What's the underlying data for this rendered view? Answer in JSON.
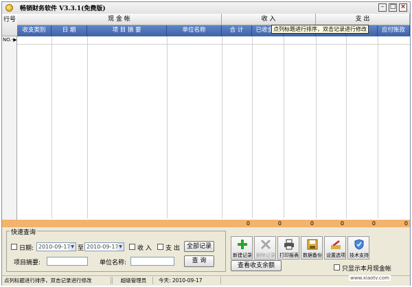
{
  "window": {
    "title": "畅销财务软件 V3.3.1(免费版)"
  },
  "grid": {
    "rownum_header": "行号",
    "groups": {
      "cash": "现 金 帐",
      "income": "收 入",
      "expense": "支 出"
    },
    "columns": [
      "收支类别",
      "日 期",
      "项 目 摘 要",
      "单位名称",
      "合 计",
      "已收金额",
      "",
      "",
      "金额",
      "应付账款"
    ],
    "first_row_label": "NO.-▶",
    "totals": [
      "0",
      "0",
      "0",
      "0",
      "0",
      "0"
    ],
    "tooltip": "点列标题进行排序，双击记录进行修改"
  },
  "quick_query": {
    "title": "快速查询",
    "date_label": "日期:",
    "date_from": "2010-09-17",
    "to_label": "至",
    "date_to": "2010-09-17",
    "income_label": "收 入",
    "expense_label": "支 出",
    "all_records_button": "全部记录",
    "summary_label": "项目摘要:",
    "unit_label": "单位名称:",
    "query_button": "查 询"
  },
  "toolbar": {
    "buttons": [
      {
        "label": "新建记录",
        "icon": "plus-icon",
        "enabled": true
      },
      {
        "label": "删除记录",
        "icon": "delete-icon",
        "enabled": false
      },
      {
        "label": "打印报表",
        "icon": "printer-icon",
        "enabled": true
      },
      {
        "label": "数据备份",
        "icon": "backup-icon",
        "enabled": true
      },
      {
        "label": "设置选项",
        "icon": "settings-icon",
        "enabled": true
      },
      {
        "label": "技术支持",
        "icon": "support-icon",
        "enabled": true
      }
    ],
    "view_balance_button": "查看收支余额",
    "month_only_checkbox": "只显示本月现金帐"
  },
  "status_bar": {
    "hint": "点列标题进行排序，双击记录进行修改",
    "user": "超级管理员",
    "today": "今天: 2010-09-17"
  },
  "watermark": "www.xiaotv.com",
  "colors": {
    "header_blue": "#4a6fb5",
    "totals_orange": "#f3b36c",
    "window_bg": "#ece9d8"
  }
}
